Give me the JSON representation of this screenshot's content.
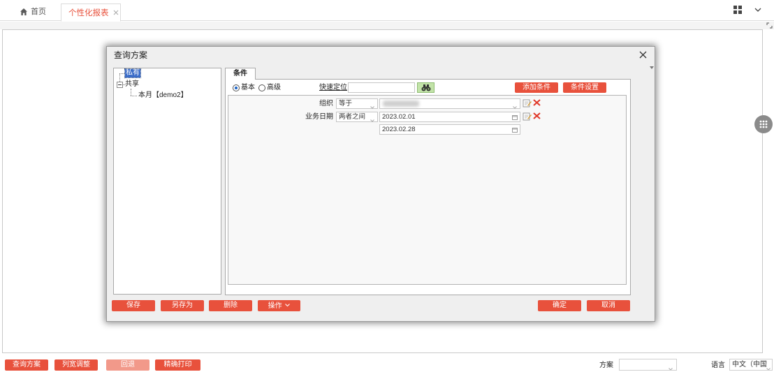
{
  "tabs": [
    {
      "label": "首页",
      "icon": "home-icon"
    },
    {
      "label": "个性化报表",
      "icon": "close-icon",
      "active": true
    }
  ],
  "header_icons": [
    "grid-menu-icon",
    "chevron-down-icon",
    "expand-corner-icon"
  ],
  "dialog": {
    "title": "查询方案",
    "tree": [
      {
        "label": "私有",
        "selected": true
      },
      {
        "label": "共享",
        "expanded": true,
        "children": [
          {
            "label": "本月【demo2】"
          }
        ]
      }
    ],
    "tab_label": "条件",
    "mode_options": [
      {
        "label": "基本",
        "selected": true
      },
      {
        "label": "高级",
        "selected": false
      }
    ],
    "quick_locate_label": "快速定位",
    "add_condition_label": "添加条件",
    "condition_settings_label": "条件设置",
    "conditions": [
      {
        "field": "组织",
        "operator": "等于"
      },
      {
        "field": "业务日期",
        "operator": "两者之间",
        "from": "2023.02.01",
        "to": "2023.02.28"
      }
    ],
    "buttons": {
      "save": "保存",
      "save_as": "另存为",
      "delete": "删除",
      "operate": "操作",
      "confirm": "确定",
      "cancel": "取消"
    }
  },
  "footer": {
    "buttons": [
      {
        "label": "查询方案",
        "enabled": true
      },
      {
        "label": "列宽调整",
        "enabled": true
      },
      {
        "label": "回退",
        "enabled": false
      },
      {
        "label": "精确打印",
        "enabled": true
      }
    ],
    "scheme_label": "方案",
    "language_label": "语言",
    "language_value": "中文（中国"
  },
  "colors": {
    "accent": "#e8513c",
    "accent_disabled": "#f2998a",
    "tree_selection": "#3a6cc8",
    "find_button": "#c2e3a8"
  }
}
